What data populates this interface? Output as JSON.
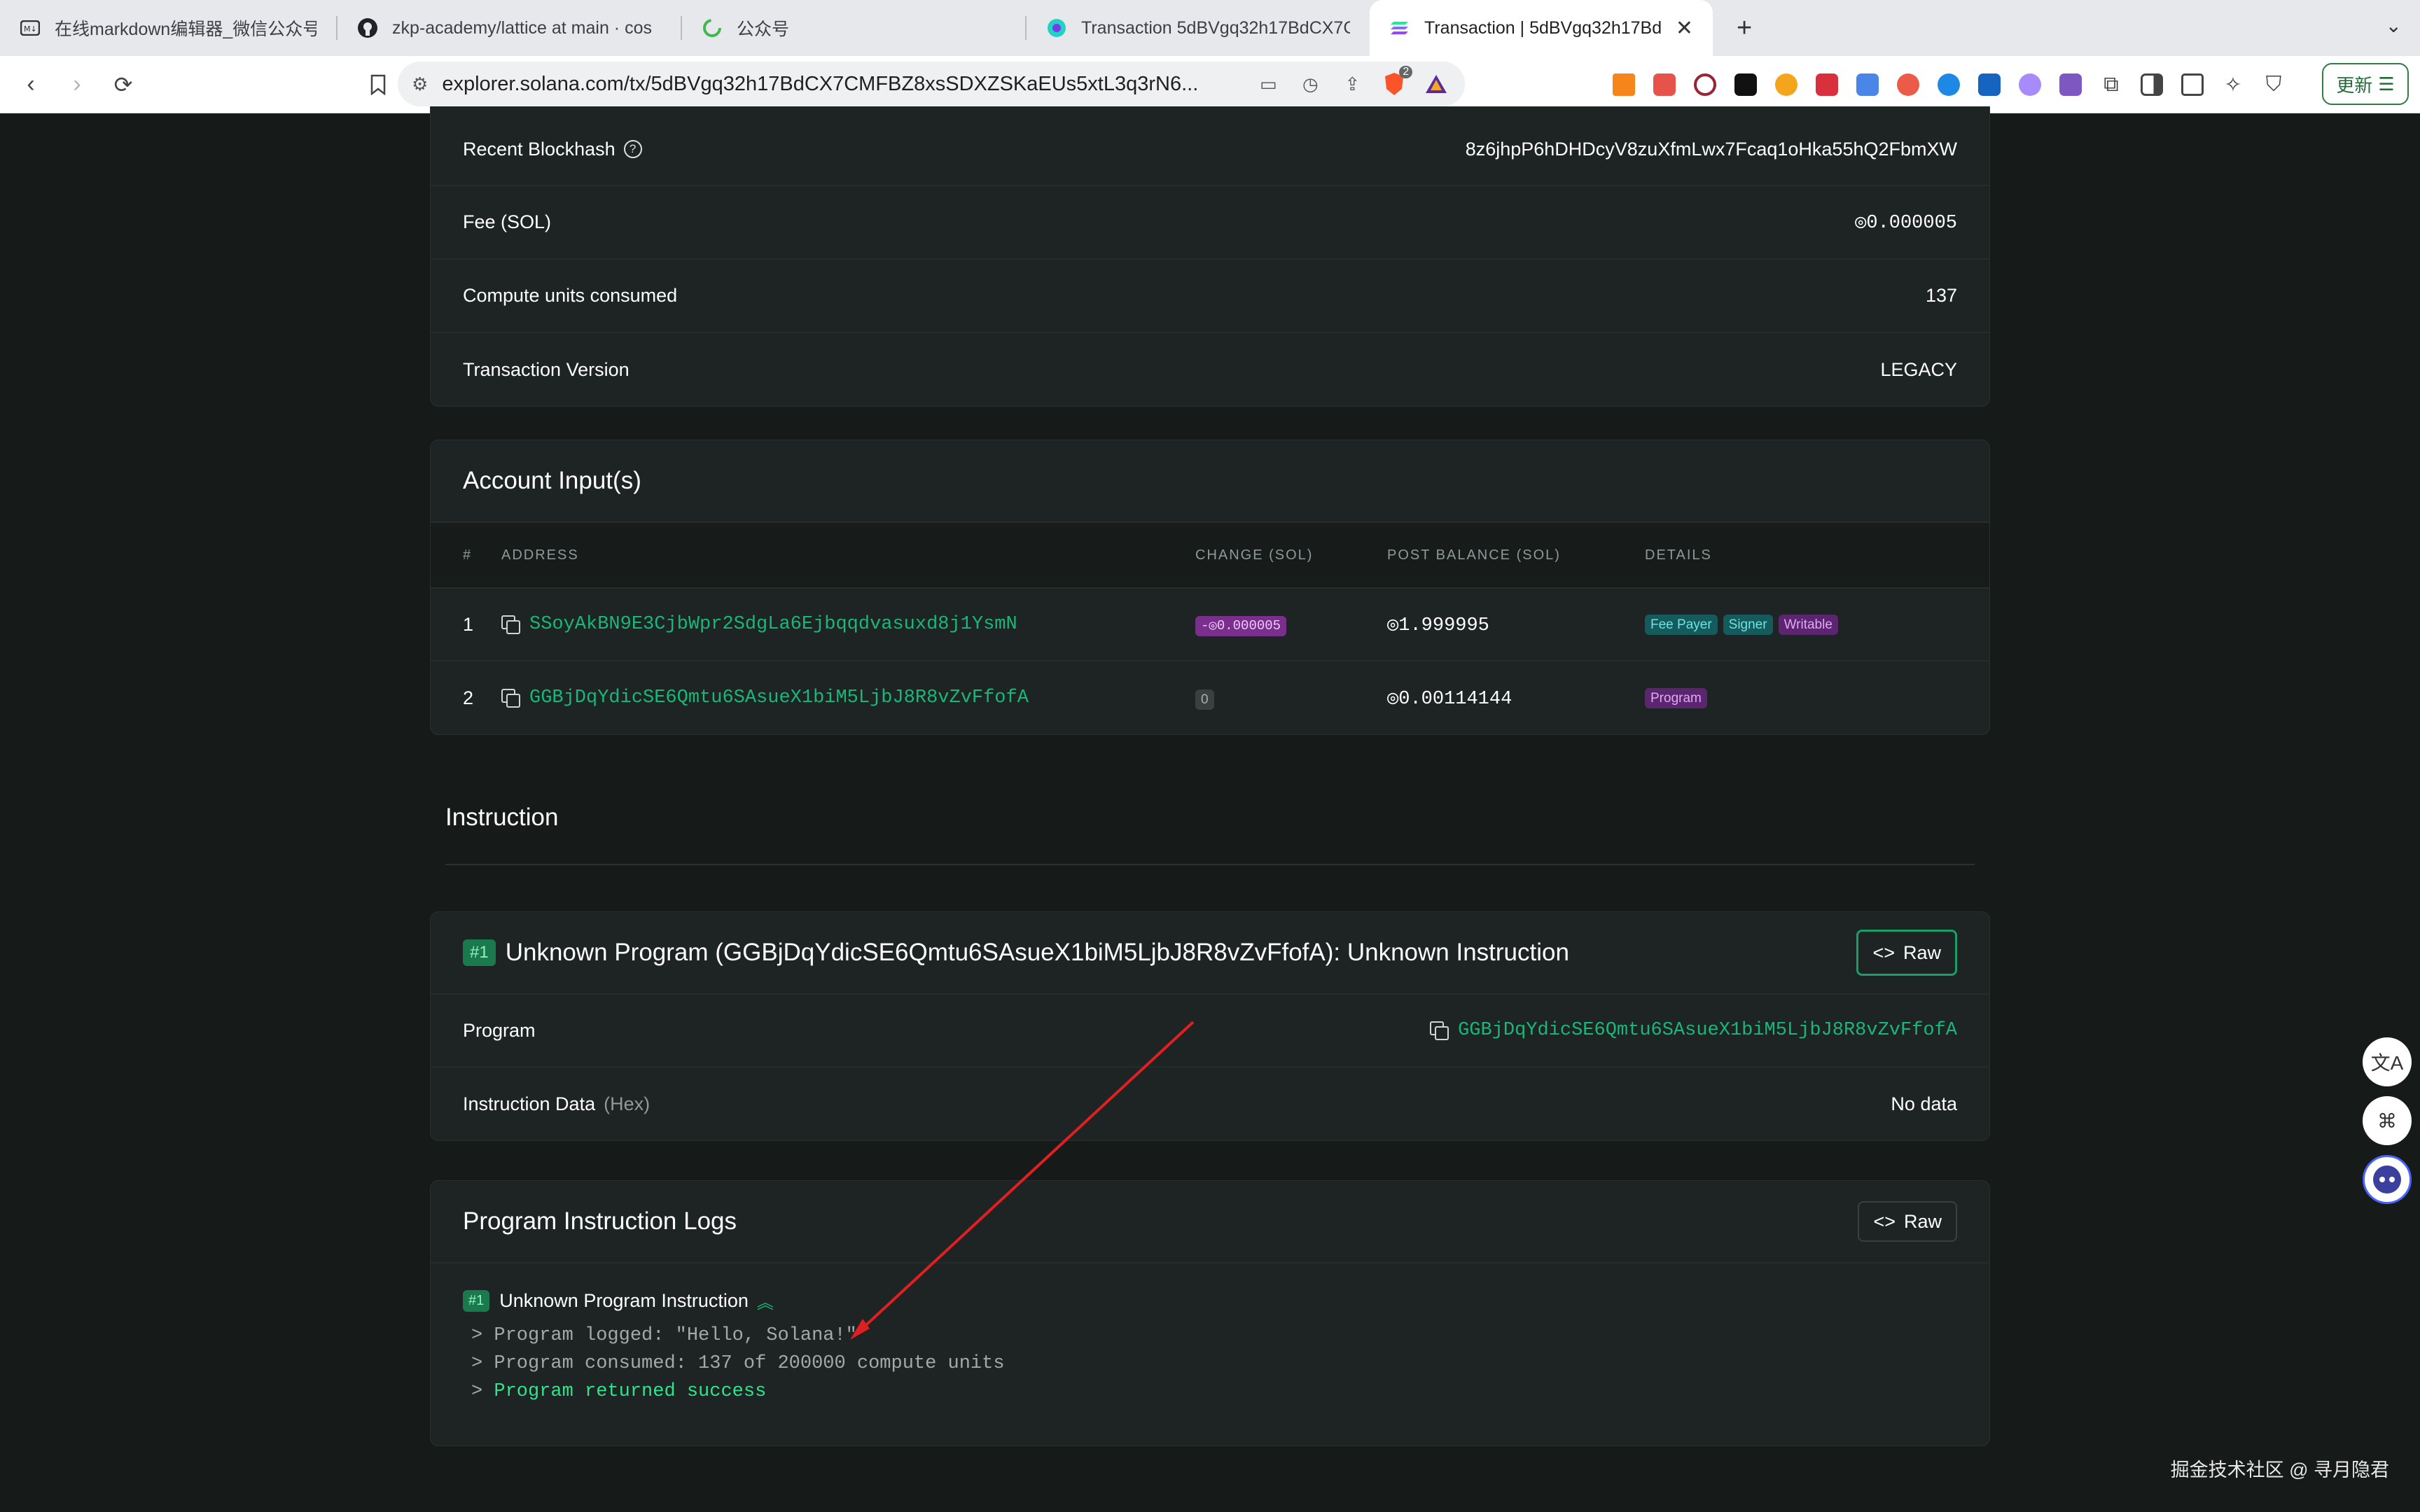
{
  "browser": {
    "tabs": [
      {
        "title": "在线markdown编辑器_微信公众号m",
        "icon": "md-editor-icon"
      },
      {
        "title": "zkp-academy/lattice at main · cos",
        "icon": "github-icon"
      },
      {
        "title": "公众号",
        "icon": "wechat-mp-icon"
      },
      {
        "title": "Transaction 5dBVgq32h17BdCX7C",
        "icon": "explorer-icon"
      },
      {
        "title": "Transaction | 5dBVgq32h17Bd",
        "icon": "solana-icon"
      }
    ],
    "url": "explorer.solana.com/tx/5dBVgq32h17BdCX7CMFBZ8xsSDXZSKaEUs5xtL3q3rN6...",
    "update_label": "更新",
    "brave_badge_count": "2"
  },
  "summary": {
    "rows": [
      {
        "label": "Recent Blockhash",
        "value": "8z6jhpP6hDHDcyV8zuXfmLwx7Fcaq1oHka55hQ2FbmXW"
      },
      {
        "label": "Fee (SOL)",
        "value": "◎0.000005"
      },
      {
        "label": "Compute units consumed",
        "value": "137"
      },
      {
        "label": "Transaction Version",
        "value": "LEGACY"
      }
    ]
  },
  "accounts": {
    "title": "Account Input(s)",
    "columns": [
      "#",
      "ADDRESS",
      "CHANGE (SOL)",
      "POST BALANCE (SOL)",
      "DETAILS"
    ],
    "rows": [
      {
        "index": "1",
        "address": "SSoyAkBN9E3CjbWpr2SdgLa6Ejbqqdvasuxd8j1YsmN",
        "change": "-◎0.000005",
        "balance": "◎1.999995",
        "tags": [
          "Fee Payer",
          "Signer",
          "Writable"
        ]
      },
      {
        "index": "2",
        "address": "GGBjDqYdicSE6Qmtu6SAsueX1biM5LjbJ8R8vZvFfofA",
        "change": "0",
        "balance": "◎0.00114144",
        "tags": [
          "Program"
        ]
      }
    ]
  },
  "instruction": {
    "section_title": "Instruction",
    "number": "#1",
    "title": "Unknown Program (GGBjDqYdicSE6Qmtu6SAsueX1biM5LjbJ8R8vZvFfofA): Unknown Instruction",
    "raw_label": "Raw",
    "program_label": "Program",
    "program_address": "GGBjDqYdicSE6Qmtu6SAsueX1biM5LjbJ8R8vZvFfofA",
    "data_label": "Instruction Data",
    "data_hint": "(Hex)",
    "data_value": "No data"
  },
  "logs": {
    "title": "Program Instruction Logs",
    "raw_label": "Raw",
    "number": "#1",
    "entry_title": "Unknown Program Instruction",
    "lines": [
      "> Program logged: \"Hello, Solana!\"",
      "> Program consumed: 137 of 200000 compute units"
    ],
    "prefix": ">",
    "success_line": "Program returned success"
  },
  "watermark": "掘金技术社区 @ 寻月隐君"
}
